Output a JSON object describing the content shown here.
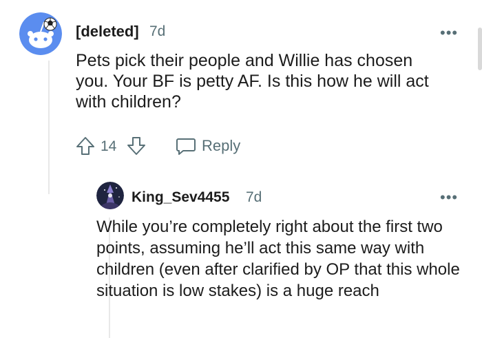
{
  "comment": {
    "username": "[deleted]",
    "age": "7d",
    "body": "Pets pick their people and Willie has chosen you. Your BF is petty AF. Is this how he will act with children?",
    "votes": "14",
    "reply_label": "Reply",
    "more_icon": "more-options-icon"
  },
  "reply": {
    "username": "King_Sev4455",
    "age": "7d",
    "body": "While you’re completely right about the first two points, assuming he’ll act this same way with children (even after clarified by OP that this whole situation is low stakes) is a huge reach",
    "more_icon": "more-options-icon"
  },
  "colors": {
    "accent_blue": "#5b8def",
    "meta_gray": "#576f76"
  }
}
